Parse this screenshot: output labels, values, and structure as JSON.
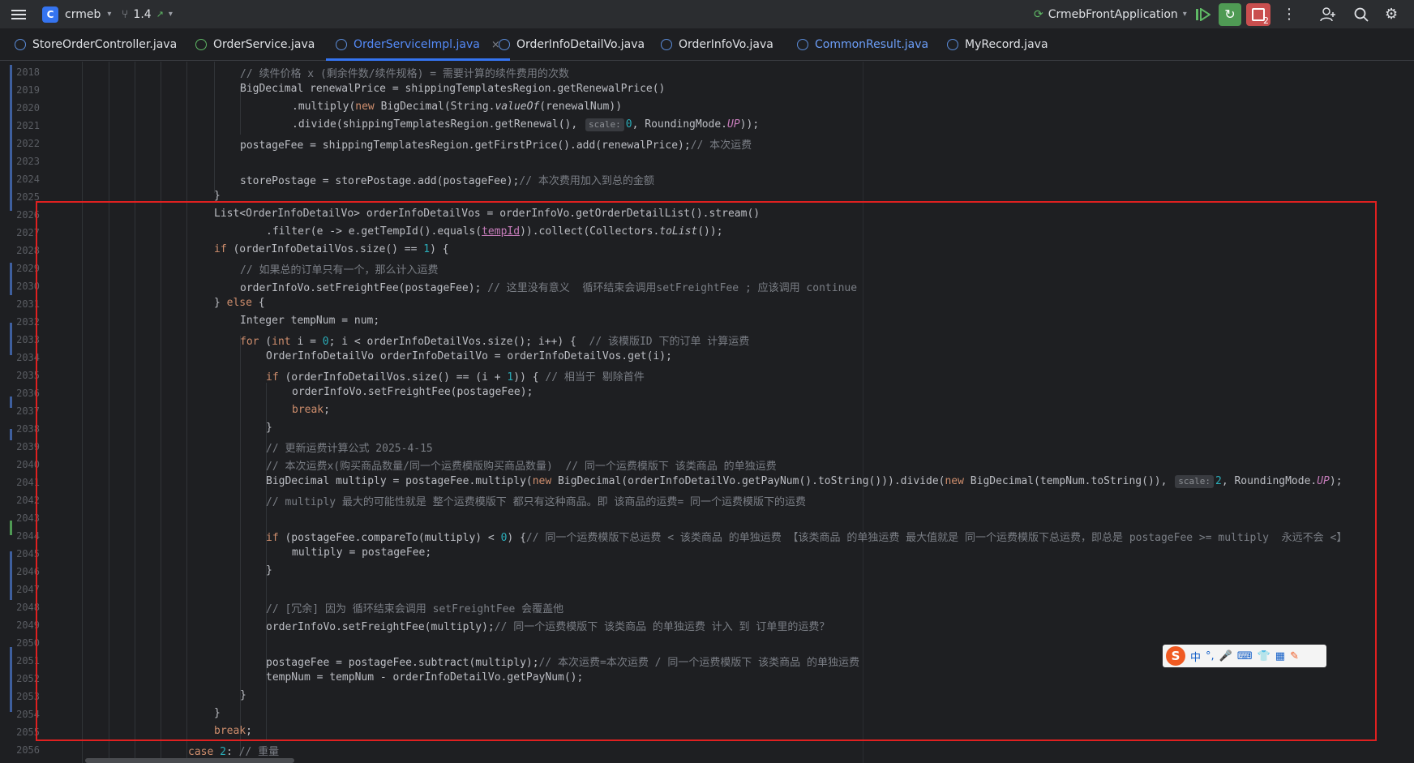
{
  "toolbar": {
    "project_letter": "C",
    "project_name": "crmeb",
    "branch": "1.4",
    "run_config": "CrmebFrontApplication",
    "badge": "2"
  },
  "tabs": [
    {
      "label": "StoreOrderController.java"
    },
    {
      "label": "OrderService.java"
    },
    {
      "label": "OrderServiceImpl.java"
    },
    {
      "label": "OrderInfoDetailVo.java"
    },
    {
      "label": "OrderInfoVo.java"
    },
    {
      "label": "CommonResult.java"
    },
    {
      "label": "MyRecord.java"
    }
  ],
  "line_numbers": [
    "2018",
    "2019",
    "2020",
    "2021",
    "2022",
    "2023",
    "2024",
    "2025",
    "2026",
    "2027",
    "2028",
    "2029",
    "2030",
    "2031",
    "2032",
    "2033",
    "2034",
    "2035",
    "2036",
    "2037",
    "2038",
    "2039",
    "2040",
    "2041",
    "2042",
    "2043",
    "2044",
    "2045",
    "2046",
    "2047",
    "2048",
    "2049",
    "2050",
    "2051",
    "2052",
    "2053",
    "2054",
    "2055",
    "2056"
  ],
  "hints": {
    "scale0": "scale:",
    "scale2": "scale:"
  },
  "code": {
    "l2018": "// 续件价格 x (剩余件数/续件规格) = 需要计算的续件费用的次数",
    "l2019": "BigDecimal renewalPrice = shippingTemplatesRegion.getRenewalPrice()",
    "l2020a": ".multiply(",
    "l2020b": "new",
    "l2020c": " BigDecimal(String.",
    "l2020d": "valueOf",
    "l2020e": "(renewalNum))",
    "l2021a": ".divide(shippingTemplatesRegion.getRenewal(), ",
    "l2021b": "0",
    "l2021c": ", RoundingMode.",
    "l2021d": "UP",
    "l2021e": "));",
    "l2022a": "postageFee = shippingTemplatesRegion.getFirstPrice().add(renewalPrice);",
    "l2022b": "// 本次运费",
    "l2024a": "storePostage = storePostage.add(postageFee);",
    "l2024b": "// 本次费用加入到总的金额",
    "l2025": "}",
    "l2026": "List<OrderInfoDetailVo> orderInfoDetailVos = orderInfoVo.getOrderDetailList().stream()",
    "l2027a": ".filter(e -> e.getTempId().equals(",
    "l2027b": "tempId",
    "l2027c": ")).collect(Collectors.",
    "l2027d": "toList",
    "l2027e": "());",
    "l2028a": "if",
    "l2028b": " (orderInfoDetailVos.size() == ",
    "l2028c": "1",
    "l2028d": ") {",
    "l2029": "// 如果总的订单只有一个，那么计入运费",
    "l2030a": "orderInfoVo.setFreightFee(postageFee); ",
    "l2030b": "// 这里没有意义  循环结束会调用setFreightFee ; 应该调用 continue",
    "l2031a": "} ",
    "l2031b": "else",
    "l2031c": " {",
    "l2032": "Integer tempNum = num;",
    "l2033a": "for",
    "l2033b": " (",
    "l2033c": "int",
    "l2033d": " i = ",
    "l2033e": "0",
    "l2033f": "; i < orderInfoDetailVos.size(); i++) {  ",
    "l2033g": "// 该模版ID 下的订单 计算运费",
    "l2034": "OrderInfoDetailVo orderInfoDetailVo = orderInfoDetailVos.get(i);",
    "l2035a": "if",
    "l2035b": " (orderInfoDetailVos.size() == (i + ",
    "l2035c": "1",
    "l2035d": ")) { ",
    "l2035e": "// 相当于 剔除首件",
    "l2036": "orderInfoVo.setFreightFee(postageFee);",
    "l2037a": "break",
    "l2037b": ";",
    "l2038": "}",
    "l2039": "// 更新运费计算公式 2025-4-15",
    "l2040": "// 本次运费x(购买商品数量/同一个运费模版购买商品数量)  // 同一个运费模版下 该类商品 的单独运费",
    "l2041a": "BigDecimal multiply = postageFee.multiply(",
    "l2041b": "new",
    "l2041c": " BigDecimal(orderInfoDetailVo.getPayNum().toString())).divide(",
    "l2041d": "new",
    "l2041e": " BigDecimal(tempNum.toString()), ",
    "l2041f": "2",
    "l2041g": ", RoundingMode.",
    "l2041h": "UP",
    "l2041i": ");",
    "l2042": "// multiply 最大的可能性就是 整个运费模版下 都只有这种商品。即 该商品的运费= 同一个运费模版下的运费",
    "l2044a": "if",
    "l2044b": " (postageFee.compareTo(multiply) < ",
    "l2044c": "0",
    "l2044d": ") {",
    "l2044e": "// 同一个运费模版下总运费 < 该类商品 的单独运费 【该类商品 的单独运费 最大值就是 同一个运费模版下总运费，即总是 postageFee >= multiply  永远不会 <】",
    "l2045": "multiply = postageFee;",
    "l2046": "}",
    "l2048": "// [冗余] 因为 循环结束会调用 setFreightFee 会覆盖他",
    "l2049a": "orderInfoVo.setFreightFee(multiply);",
    "l2049b": "// 同一个运费模版下 该类商品 的单独运费 计入 到 订单里的运费？",
    "l2051a": "postageFee = postageFee.subtract(multiply);",
    "l2051b": "// 本次运费=本次运费 / 同一个运费模版下 该类商品 的单独运费",
    "l2052": "tempNum = tempNum - orderInfoDetailVo.getPayNum();",
    "l2053": "}",
    "l2054": "}",
    "l2055a": "break",
    "l2055b": ";",
    "l2056a": "case ",
    "l2056b": "2",
    "l2056c": ": ",
    "l2056d": "// 重量"
  },
  "ime": {
    "label": "中",
    "punct": "°,"
  }
}
